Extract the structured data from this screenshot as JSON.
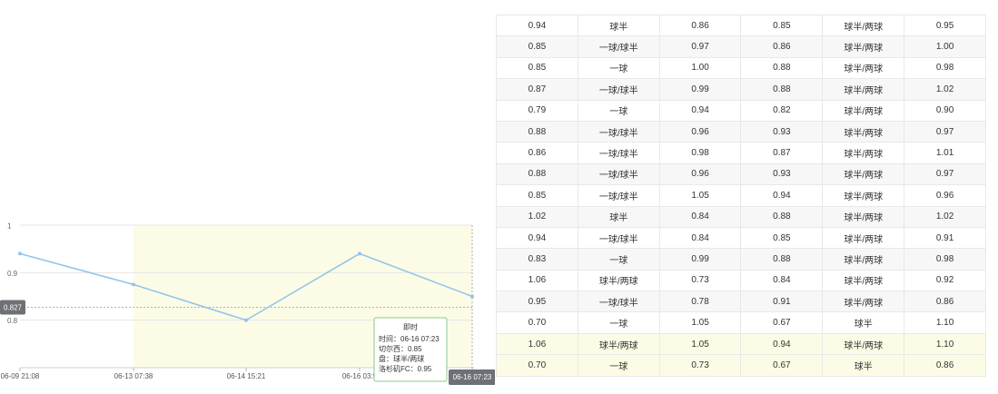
{
  "chart_data": {
    "type": "line",
    "x": [
      "06-09 21:08",
      "06-13 07:38",
      "06-14 15:21",
      "06-16 03:5",
      "06-16 07:23"
    ],
    "values": [
      0.94,
      0.875,
      0.8,
      0.94,
      0.85
    ],
    "xticks": [
      "06-09 21:08",
      "06-13 07:38",
      "06-14 15:21",
      "06-16 03:5",
      "06-16 07:23"
    ],
    "yticks": [
      "1",
      "0.9",
      "0.8"
    ],
    "ylim": [
      0.7,
      1.0
    ],
    "grid": true,
    "highlight_band": {
      "from": "06-13 07:38",
      "to": "06-16 07:23",
      "color": "#fcfce6"
    },
    "crosshair": {
      "y": 0.827,
      "y_label": "0.827",
      "x_label": "06-16 07:23"
    },
    "tooltip": {
      "title": "即时",
      "lines": [
        "时间：06-16 07:23",
        "切尔西：0.85",
        "盘：球半/两球",
        "洛杉矶FC：0.95"
      ]
    },
    "line_color": "#93c5ea"
  },
  "table": {
    "rows": [
      [
        "0.94",
        "球半",
        "0.86",
        "0.85",
        "球半/两球",
        "0.95"
      ],
      [
        "0.85",
        "一球/球半",
        "0.97",
        "0.86",
        "球半/两球",
        "1.00"
      ],
      [
        "0.85",
        "一球",
        "1.00",
        "0.88",
        "球半/两球",
        "0.98"
      ],
      [
        "0.87",
        "一球/球半",
        "0.99",
        "0.88",
        "球半/两球",
        "1.02"
      ],
      [
        "0.79",
        "一球",
        "0.94",
        "0.82",
        "球半/两球",
        "0.90"
      ],
      [
        "0.88",
        "一球/球半",
        "0.96",
        "0.93",
        "球半/两球",
        "0.97"
      ],
      [
        "0.86",
        "一球/球半",
        "0.98",
        "0.87",
        "球半/两球",
        "1.01"
      ],
      [
        "0.88",
        "一球/球半",
        "0.96",
        "0.93",
        "球半/两球",
        "0.97"
      ],
      [
        "0.85",
        "一球/球半",
        "1.05",
        "0.94",
        "球半/两球",
        "0.96"
      ],
      [
        "1.02",
        "球半",
        "0.84",
        "0.88",
        "球半/两球",
        "1.02"
      ],
      [
        "0.94",
        "一球/球半",
        "0.84",
        "0.85",
        "球半/两球",
        "0.91"
      ],
      [
        "0.83",
        "一球",
        "0.99",
        "0.88",
        "球半/两球",
        "0.98"
      ],
      [
        "1.06",
        "球半/两球",
        "0.73",
        "0.84",
        "球半/两球",
        "0.92"
      ],
      [
        "0.95",
        "一球/球半",
        "0.78",
        "0.91",
        "球半/两球",
        "0.86"
      ],
      [
        "0.70",
        "一球",
        "1.05",
        "0.67",
        "球半",
        "1.10"
      ],
      [
        "1.06",
        "球半/两球",
        "1.05",
        "0.94",
        "球半/两球",
        "1.10"
      ],
      [
        "0.70",
        "一球",
        "0.73",
        "0.67",
        "球半",
        "0.86"
      ]
    ],
    "highlight_rows": [
      15,
      16
    ]
  }
}
